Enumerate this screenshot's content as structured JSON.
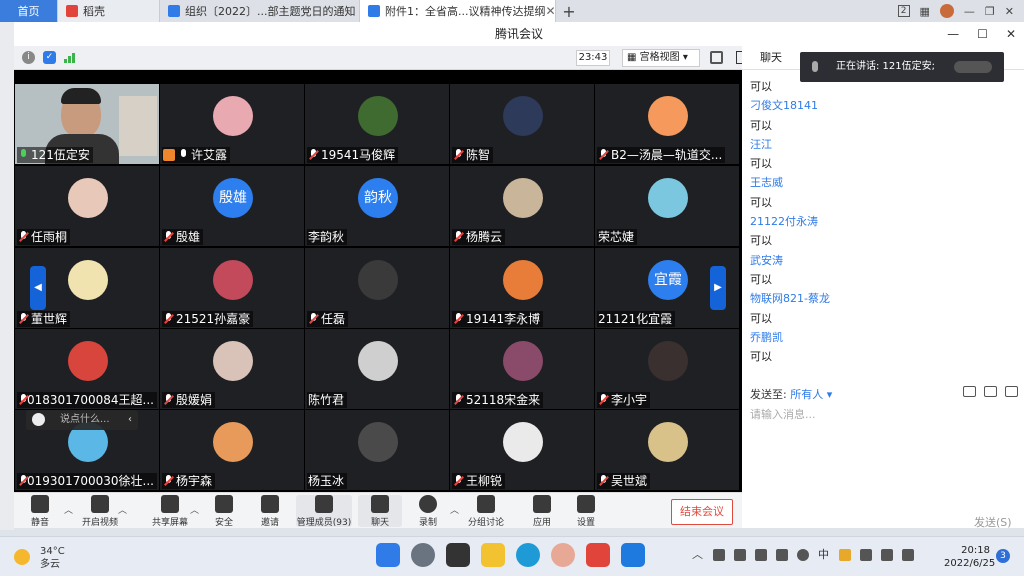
{
  "browser": {
    "tabs": [
      {
        "label": "首页"
      },
      {
        "label": "稻壳"
      },
      {
        "label": "组织〔2022〕...部主题党日的通知"
      },
      {
        "label": "附件1：全省高...议精神传达提纲"
      }
    ],
    "new_tab": "+",
    "badge": "2"
  },
  "meeting": {
    "window_title": "腾讯会议",
    "timer": "23:43",
    "view_mode": "宫格视图",
    "chat_tab": "聊天",
    "speaking": "正在讲话: 121伍定安;"
  },
  "participants": [
    {
      "name": "121伍定安",
      "mic": "on",
      "avatar": "video"
    },
    {
      "name": "许艾露",
      "mic": "plain",
      "avatar": "img",
      "host": true,
      "color": "#e9a9b0"
    },
    {
      "name": "19541马俊辉",
      "mic": "muted",
      "avatar": "img",
      "color": "#3f6a30"
    },
    {
      "name": "陈智",
      "mic": "muted",
      "avatar": "img",
      "color": "#2d3a5a"
    },
    {
      "name": "B2—汤晨—轨道交...",
      "mic": "muted",
      "avatar": "img",
      "color": "#f59a5c"
    },
    {
      "name": "任雨桐",
      "mic": "muted",
      "avatar": "img",
      "color": "#e8c8b8"
    },
    {
      "name": "殷雄",
      "mic": "muted",
      "avatar": "text",
      "text": "殷雄"
    },
    {
      "name": "李韵秋",
      "mic": "none",
      "avatar": "text",
      "text": "韵秋"
    },
    {
      "name": "杨腾云",
      "mic": "muted",
      "avatar": "img",
      "color": "#c9b59a"
    },
    {
      "name": "荣芯婕",
      "mic": "none",
      "avatar": "img",
      "color": "#7cc7e0"
    },
    {
      "name": "董世辉",
      "mic": "muted",
      "avatar": "img",
      "color": "#f0e3b0"
    },
    {
      "name": "21521孙嘉豪",
      "mic": "muted",
      "avatar": "img",
      "color": "#c24a5a"
    },
    {
      "name": "任磊",
      "mic": "muted",
      "avatar": "img",
      "color": "#3a3a3a"
    },
    {
      "name": "19141李永博",
      "mic": "muted",
      "avatar": "img",
      "color": "#e87d3a"
    },
    {
      "name": "21121化宜霞",
      "mic": "none",
      "avatar": "text",
      "text": "宜霞"
    },
    {
      "name": "018301700084王超...",
      "mic": "muted",
      "avatar": "img",
      "color": "#d8453c"
    },
    {
      "name": "殷媛娟",
      "mic": "muted",
      "avatar": "img",
      "color": "#d9c2b8"
    },
    {
      "name": "陈竹君",
      "mic": "none",
      "avatar": "img",
      "color": "#cfcfcf"
    },
    {
      "name": "52118宋金来",
      "mic": "muted",
      "avatar": "img",
      "color": "#8a4a6a"
    },
    {
      "name": "李小宇",
      "mic": "muted",
      "avatar": "img",
      "color": "#3a3030"
    },
    {
      "name": "019301700030徐壮...",
      "mic": "muted",
      "avatar": "img",
      "color": "#5bb7e6"
    },
    {
      "name": "杨宇森",
      "mic": "muted",
      "avatar": "img",
      "color": "#e89a5a"
    },
    {
      "name": "杨玉冰",
      "mic": "none",
      "avatar": "img",
      "color": "#4a4a4a"
    },
    {
      "name": "王柳锐",
      "mic": "muted",
      "avatar": "img",
      "color": "#eaeaea"
    },
    {
      "name": "吴世斌",
      "mic": "muted",
      "avatar": "img",
      "color": "#d8c28a"
    }
  ],
  "chat_input_overlay": {
    "placeholder": "说点什么..."
  },
  "toolbar": [
    {
      "label": "静音"
    },
    {
      "label": "开启视频"
    },
    {
      "label": "共享屏幕"
    },
    {
      "label": "安全"
    },
    {
      "label": "邀请"
    },
    {
      "label": "管理成员(93)"
    },
    {
      "label": "聊天"
    },
    {
      "label": "录制"
    },
    {
      "label": "分组讨论"
    },
    {
      "label": "应用"
    },
    {
      "label": "设置"
    }
  ],
  "end_meeting": "结束会议",
  "chat": {
    "messages": [
      {
        "text": "可以",
        "kind": "msg"
      },
      {
        "text": "刁俊文18141",
        "kind": "sender"
      },
      {
        "text": "可以",
        "kind": "msg"
      },
      {
        "text": "汪江",
        "kind": "sender"
      },
      {
        "text": "可以",
        "kind": "msg"
      },
      {
        "text": "王志威",
        "kind": "sender"
      },
      {
        "text": "可以",
        "kind": "msg"
      },
      {
        "text": "21122付永涛",
        "kind": "sender"
      },
      {
        "text": "可以",
        "kind": "msg"
      },
      {
        "text": "武安涛",
        "kind": "sender"
      },
      {
        "text": "可以",
        "kind": "msg"
      },
      {
        "text": "物联网821-蔡龙",
        "kind": "sender"
      },
      {
        "text": "可以",
        "kind": "msg"
      },
      {
        "text": "乔鹏凯",
        "kind": "sender"
      },
      {
        "text": "可以",
        "kind": "msg"
      }
    ],
    "send_to_label": "发送至:",
    "send_to_value": "所有人",
    "input_placeholder": "请输入消息...",
    "send_button": "发送(S)"
  },
  "taskbar": {
    "temperature": "34°C",
    "weather": "多云",
    "time": "20:18",
    "date": "2022/6/25",
    "notifications": "3",
    "ime": "中"
  }
}
